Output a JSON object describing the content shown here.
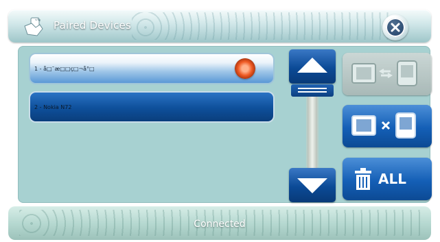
{
  "header": {
    "title": "Paired Devices",
    "icon": "hand-phone-icon",
    "close_icon": "close-icon"
  },
  "devices": [
    {
      "label": "1 - å□¯æ□□ç□¬å°□",
      "selected": true,
      "status_icon": "connected-indicator-icon"
    },
    {
      "label": "2 - Nokia N72",
      "selected": false
    }
  ],
  "scroll": {
    "up_icon": "arrow-up-icon",
    "down_icon": "arrow-down-icon"
  },
  "actions": {
    "connect_icon": "connect-device-icon",
    "connect_enabled": false,
    "disconnect_icon": "disconnect-device-icon",
    "delete_all_icon": "trash-icon",
    "delete_all_label": "ALL"
  },
  "footer": {
    "status": "Connected"
  },
  "colors": {
    "accent_blue": "#0e4f9a",
    "panel": "#a7d1d1",
    "indicator": "#ef5a24"
  }
}
